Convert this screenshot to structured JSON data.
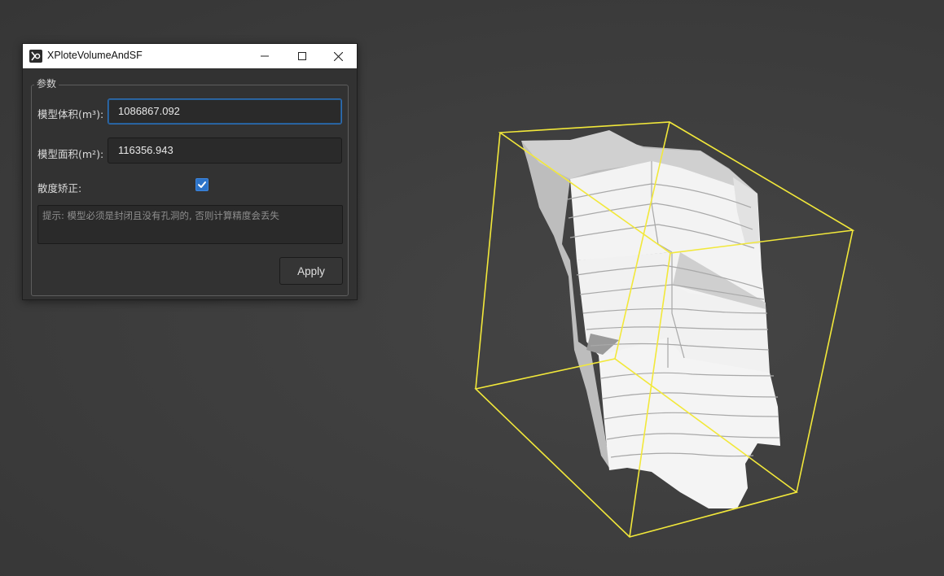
{
  "window": {
    "title": "XPloteVolumeAndSF",
    "icon": "app-logo-icon",
    "controls": [
      "minimize-icon",
      "maximize-icon",
      "close-icon"
    ]
  },
  "params": {
    "group_title": "参数",
    "volume_label": "模型体积(m³):",
    "volume_value": "1086867.092",
    "area_label": "模型面积(m²):",
    "area_value": "116356.943",
    "scatter_label": "散度矫正:",
    "scatter_checked": true,
    "hint": "提示: 模型必须是封闭且没有孔洞的, 否则计算精度会丢失",
    "apply_label": "Apply"
  },
  "colors": {
    "viewport_bg": "#3d3d3d",
    "bounding_box": "#f2e83a",
    "model": "#f0f0f0",
    "accent": "#2c73c8"
  }
}
